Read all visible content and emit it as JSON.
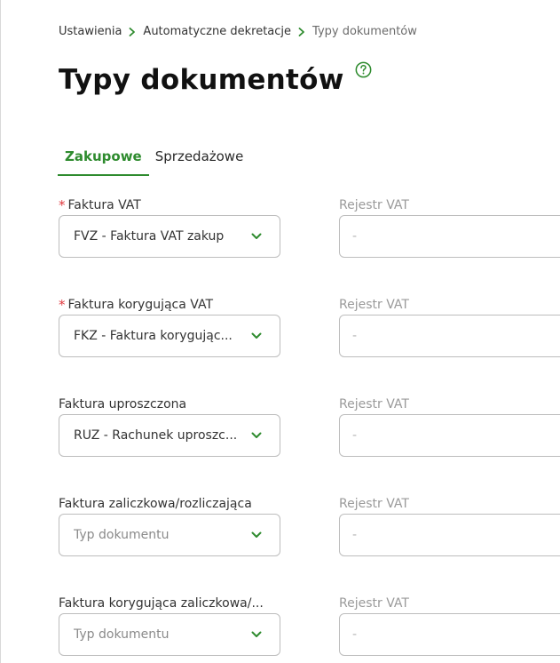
{
  "breadcrumb": {
    "items": [
      "Ustawienia",
      "Automatyczne dekretacje",
      "Typy dokumentów"
    ]
  },
  "page": {
    "title": "Typy dokumentów"
  },
  "tabs": [
    {
      "label": "Zakupowe",
      "active": true
    },
    {
      "label": "Sprzedażowe",
      "active": false
    }
  ],
  "fields": [
    {
      "label": "Faktura VAT",
      "required": true,
      "value": "FVZ - Faktura VAT zakup",
      "placeholder": false,
      "register_label": "Rejestr VAT",
      "register_value": "-"
    },
    {
      "label": "Faktura korygująca VAT",
      "required": true,
      "value": "FKZ - Faktura korygując...",
      "placeholder": false,
      "register_label": "Rejestr VAT",
      "register_value": "-"
    },
    {
      "label": "Faktura uproszczona",
      "required": false,
      "value": "RUZ - Rachunek uproszc...",
      "placeholder": false,
      "register_label": "Rejestr VAT",
      "register_value": "-"
    },
    {
      "label": "Faktura zaliczkowa/rozliczająca",
      "required": false,
      "value": "Typ dokumentu",
      "placeholder": true,
      "register_label": "Rejestr VAT",
      "register_value": "-"
    },
    {
      "label": "Faktura korygująca zaliczkowa/...",
      "required": false,
      "value": "Typ dokumentu",
      "placeholder": true,
      "register_label": "Rejestr VAT",
      "register_value": "-"
    }
  ],
  "colors": {
    "accent": "#2e8b2e",
    "required": "#e0393e"
  }
}
